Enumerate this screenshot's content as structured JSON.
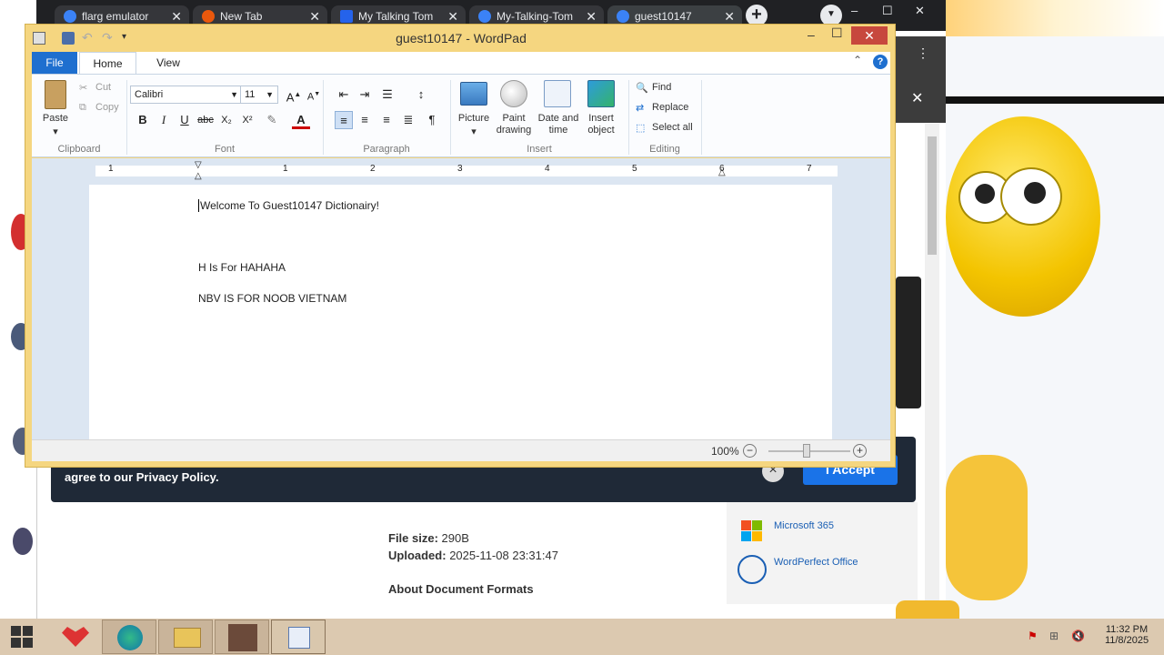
{
  "browser": {
    "tabs": [
      {
        "label": "flarg emulator",
        "icon": "edge-icon",
        "color": "#3b82f6"
      },
      {
        "label": "New Tab",
        "icon": "chrome-icon",
        "color": "#ea580c"
      },
      {
        "label": "My Talking Tom",
        "icon": "mft-icon",
        "color": "#2563eb"
      },
      {
        "label": "My-Talking-Tom",
        "icon": "edge-icon",
        "color": "#3b82f6"
      },
      {
        "label": "guest10147",
        "icon": "edge-icon",
        "color": "#3b82f6"
      }
    ],
    "new_tab": "+",
    "window_controls": {
      "min": "–",
      "max": "☐",
      "close": "✕"
    }
  },
  "webpage": {
    "cookie_text": "agree to our Privacy Policy.",
    "accept_label": "I Accept",
    "close_icon": "×",
    "file_size_label": "File size:",
    "file_size_value": "290B",
    "uploaded_label": "Uploaded:",
    "uploaded_value": "2025-11-08 23:31:47",
    "about_formats": "About Document Formats",
    "apps": [
      "Microsoft 365",
      "WordPerfect Office"
    ]
  },
  "wordpad": {
    "title": "guest10147 - WordPad",
    "tabs": {
      "file": "File",
      "home": "Home",
      "view": "View"
    },
    "clipboard": {
      "paste": "Paste",
      "cut": "Cut",
      "copy": "Copy",
      "group": "Clipboard"
    },
    "font": {
      "name": "Calibri",
      "size": "11",
      "group": "Font",
      "bold": "B",
      "italic": "I",
      "underline": "U",
      "strike": "abc",
      "sub": "X₂",
      "sup": "X²"
    },
    "paragraph": {
      "group": "Paragraph"
    },
    "insert": {
      "picture": "Picture",
      "paint": "Paint drawing",
      "datetime": "Date and time",
      "object": "Insert object",
      "group": "Insert"
    },
    "editing": {
      "find": "Find",
      "replace": "Replace",
      "select_all": "Select all",
      "group": "Editing"
    },
    "ruler_numbers": [
      "1",
      "1",
      "2",
      "3",
      "4",
      "5",
      "6",
      "7"
    ],
    "document": [
      "Welcome To Guest10147 Dictionairy!",
      "H Is For HAHAHA",
      "NBV IS FOR NOOB VIETNAM"
    ],
    "zoom": "100%",
    "zoom_level": 1.0
  },
  "taskbar": {
    "time": "11:32 PM",
    "date": "11/8/2025"
  }
}
